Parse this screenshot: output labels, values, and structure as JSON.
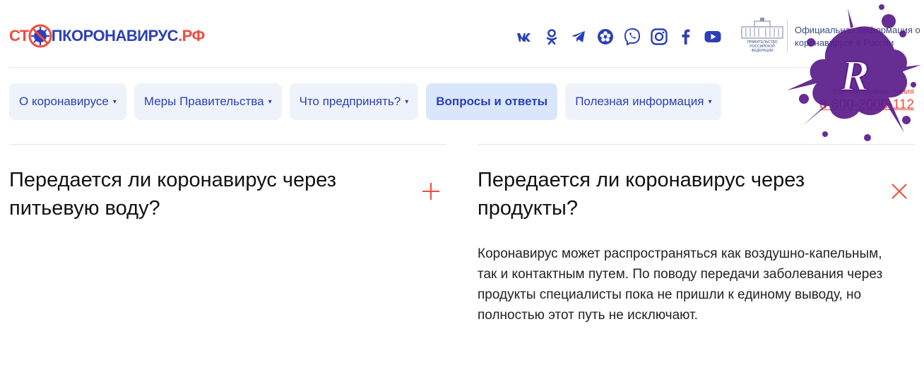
{
  "header": {
    "logo": {
      "part1": "СТ",
      "part2": "ПКОРОНАВИРУС",
      "part3": ".РФ"
    },
    "socials": [
      "vk-icon",
      "ok-icon",
      "telegram-icon",
      "flower-icon",
      "viber-icon",
      "instagram-icon",
      "facebook-icon",
      "youtube-icon"
    ],
    "gov_emblem_text": "ПРАВИТЕЛЬСТВО РОССИЙСКОЙ ФЕДЕРАЦИИ",
    "gov_text": "Официальная информация о коронавирусе в России"
  },
  "nav": {
    "items": [
      {
        "label": "О коронавирусе",
        "has_caret": true
      },
      {
        "label": "Меры Правительства",
        "has_caret": true
      },
      {
        "label": "Что предпринять?",
        "has_caret": true
      },
      {
        "label": "Вопросы и ответы",
        "has_caret": false,
        "active": true
      },
      {
        "label": "Полезная информация",
        "has_caret": true
      }
    ],
    "caret": "▾"
  },
  "hotline": {
    "label": "Единая горячая линия",
    "phone": "8-800-2000-112"
  },
  "faq": {
    "left": {
      "question": "Передается ли коронавирус через питьевую воду?",
      "state": "collapsed"
    },
    "right": {
      "question": "Передается ли коронавирус через продукты?",
      "state": "expanded",
      "answer": "Коронавирус может распространяться как воздушно-капельным, так и контактным путем. По поводу передачи заболевания через продукты специалисты пока не пришли к единому выводу, но полностью этот путь не исключают."
    }
  },
  "colors": {
    "brand_blue": "#2c3fb8",
    "brand_red": "#ef4b3c",
    "nav_bg": "#eef3fb",
    "nav_active_bg": "#d9e6fb",
    "splash_purple": "#5a1d8a"
  }
}
